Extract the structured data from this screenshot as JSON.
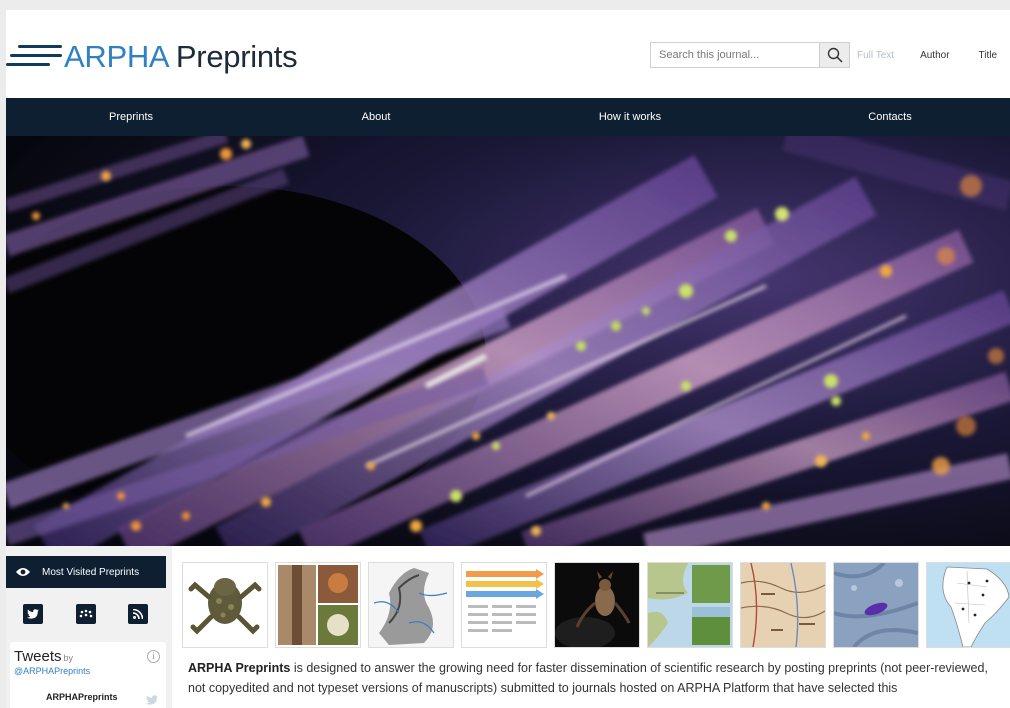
{
  "header": {
    "logo_brand": "ARPHA",
    "logo_rest": " Preprints",
    "search_placeholder": "Search this journal...",
    "search_options": [
      "Full Text",
      "Author",
      "Title"
    ]
  },
  "nav": {
    "items": [
      "Preprints",
      "About",
      "How it works",
      "Contacts"
    ]
  },
  "sidebar": {
    "most_visited_label": "Most Visited Preprints",
    "social_icons": [
      "twitter-icon",
      "mendeley-icon",
      "rss-icon"
    ],
    "tweets": {
      "title": "Tweets",
      "by": "by",
      "handle": "@ARPHAPreprints",
      "user": "ARPHAPreprints"
    }
  },
  "main": {
    "thumbnails": [
      "frog",
      "insect-plates",
      "relief-map",
      "flowchart",
      "bat",
      "coastal-map",
      "historic-map",
      "micrograph",
      "south-america-map"
    ],
    "description_bold": "ARPHA Preprints",
    "description_rest": " is designed to answer the growing need for faster dissemination of scientific research by posting preprints (not peer-reviewed, not copyedited and not typeset versions of manuscripts) submitted to journals hosted on ARPHA Platform that have selected this"
  },
  "colors": {
    "nav_bg": "#0d1f31",
    "brand_blue": "#2f80c4",
    "link_blue": "#2f80c4"
  }
}
